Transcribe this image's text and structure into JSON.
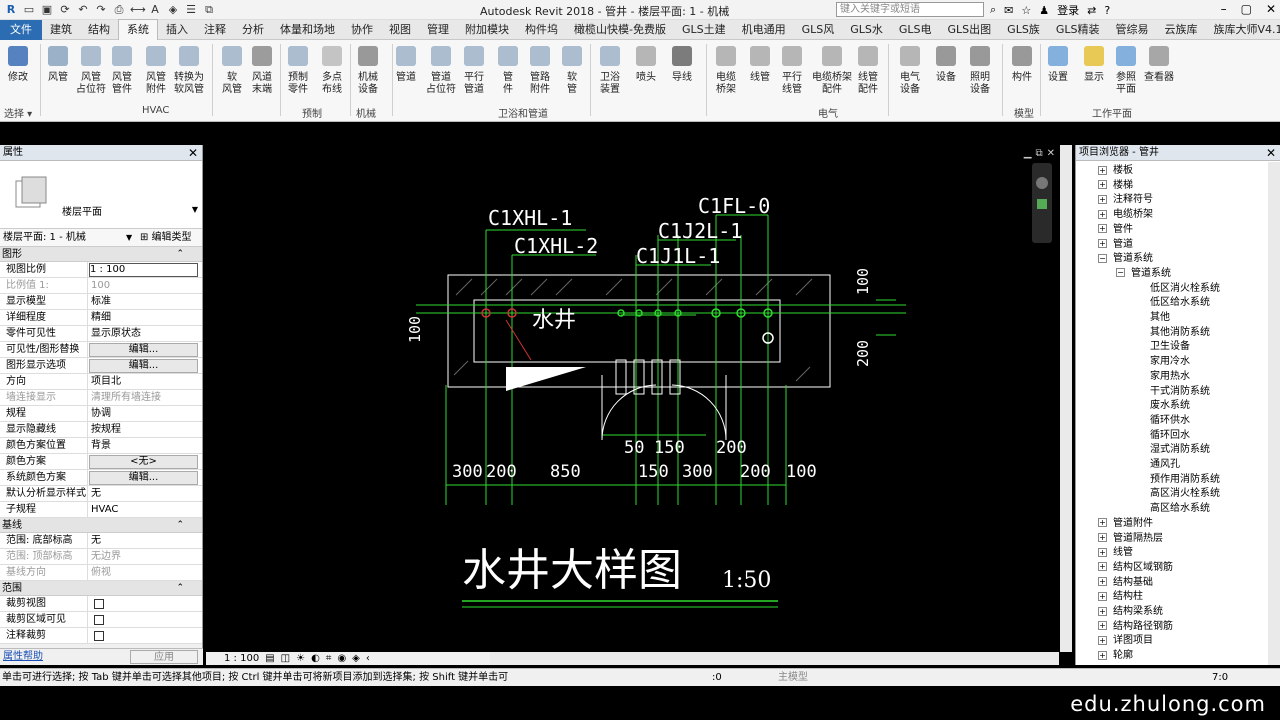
{
  "app_title": "Autodesk Revit 2018 -   管井 - 楼层平面: 1 - 机械",
  "search_placeholder": "键入关键字或短语",
  "login": "登录",
  "tabs": [
    "文件",
    "建筑",
    "结构",
    "系统",
    "插入",
    "注释",
    "分析",
    "体量和场地",
    "协作",
    "视图",
    "管理",
    "附加模块",
    "构件坞",
    "橄榄山快模-免费版",
    "GLS土建",
    "机电通用",
    "GLS风",
    "GLS水",
    "GLS电",
    "GLS出图",
    "GLS族",
    "GLS精装",
    "管综易",
    "云族库",
    "族库大师V4.1"
  ],
  "active_tab": "系统",
  "ribbon": {
    "buttons": [
      "修改",
      "风管",
      "风管\n占位符",
      "风管\n管件",
      "风管\n附件",
      "转换为\n软风管",
      "软\n风管",
      "风道\n末端",
      "预制\n零件",
      "多点\n布线",
      "机械\n设备",
      "管道",
      "管道\n占位符",
      "平行\n管道",
      "管\n件",
      "管路\n附件",
      "软\n管",
      "卫浴\n装置",
      "喷头",
      "导线",
      "电缆\n桥架",
      "线管",
      "平行\n线管",
      "电缆桥架\n配件",
      "线管\n配件",
      "电气\n设备",
      "设备",
      "照明\n设备",
      "构件",
      "设置",
      "显示",
      "参照\n平面",
      "查看器"
    ],
    "groups": [
      "选择 ▾",
      "HVAC",
      "预制",
      "机械",
      "卫浴和管道",
      "电气",
      "模型",
      "工作平面"
    ]
  },
  "properties": {
    "title": "属性",
    "type_name": "楼层平面",
    "instance": "楼层平面: 1 - 机械",
    "edit_type": "编辑类型",
    "sections": {
      "graphics": "图形",
      "underlay": "基线",
      "extents": "范围"
    },
    "rows": [
      [
        "视图比例",
        "1 : 100"
      ],
      [
        "比例值 1:",
        "100"
      ],
      [
        "显示模型",
        "标准"
      ],
      [
        "详细程度",
        "精细"
      ],
      [
        "零件可见性",
        "显示原状态"
      ],
      [
        "可见性/图形替换",
        "编辑..."
      ],
      [
        "图形显示选项",
        "编辑..."
      ],
      [
        "方向",
        "项目北"
      ],
      [
        "墙连接显示",
        "清理所有墙连接"
      ],
      [
        "规程",
        "协调"
      ],
      [
        "显示隐藏线",
        "按规程"
      ],
      [
        "颜色方案位置",
        "背景"
      ],
      [
        "颜色方案",
        "<无>"
      ],
      [
        "系统颜色方案",
        "编辑..."
      ],
      [
        "默认分析显示样式",
        "无"
      ],
      [
        "子规程",
        "HVAC"
      ]
    ],
    "underlay_rows": [
      [
        "范围: 底部标高",
        "无"
      ],
      [
        "范围: 顶部标高",
        "无边界"
      ],
      [
        "基线方向",
        "俯视"
      ]
    ],
    "extents_rows": [
      "裁剪视图",
      "裁剪区域可见",
      "注释裁剪"
    ],
    "help": "属性帮助",
    "apply": "应用"
  },
  "drawing": {
    "pipe_labels": [
      "C1XHL-1",
      "C1XHL-2",
      "C1FL-0",
      "C1J2L-1",
      "C1J1L-1"
    ],
    "shaft_label": "水井",
    "title": "水井大样图",
    "scale": "1:50",
    "dims_bottom": [
      "300",
      "200",
      "850",
      "150",
      "300",
      "200",
      "100"
    ],
    "dims_inner": [
      "50",
      "150",
      "200"
    ],
    "dims_side": [
      "100",
      "100",
      "200"
    ]
  },
  "view_scale": "1 : 100",
  "browser": {
    "title": "项目浏览器 - 管井",
    "items": [
      {
        "label": "楼板",
        "level": 0,
        "exp": "+"
      },
      {
        "label": "楼梯",
        "level": 0,
        "exp": "+"
      },
      {
        "label": "注释符号",
        "level": 0,
        "exp": "+"
      },
      {
        "label": "电缆桥架",
        "level": 0,
        "exp": "+"
      },
      {
        "label": "管件",
        "level": 0,
        "exp": "+"
      },
      {
        "label": "管道",
        "level": 0,
        "exp": "+"
      },
      {
        "label": "管道系统",
        "level": 0,
        "exp": "-"
      },
      {
        "label": "管道系统",
        "level": 1,
        "exp": "-"
      },
      {
        "label": "低区消火栓系统",
        "level": 2,
        "exp": ""
      },
      {
        "label": "低区给水系统",
        "level": 2,
        "exp": ""
      },
      {
        "label": "其他",
        "level": 2,
        "exp": ""
      },
      {
        "label": "其他消防系统",
        "level": 2,
        "exp": ""
      },
      {
        "label": "卫生设备",
        "level": 2,
        "exp": ""
      },
      {
        "label": "家用冷水",
        "level": 2,
        "exp": ""
      },
      {
        "label": "家用热水",
        "level": 2,
        "exp": ""
      },
      {
        "label": "干式消防系统",
        "level": 2,
        "exp": ""
      },
      {
        "label": "废水系统",
        "level": 2,
        "exp": ""
      },
      {
        "label": "循环供水",
        "level": 2,
        "exp": ""
      },
      {
        "label": "循环回水",
        "level": 2,
        "exp": ""
      },
      {
        "label": "湿式消防系统",
        "level": 2,
        "exp": ""
      },
      {
        "label": "通风孔",
        "level": 2,
        "exp": ""
      },
      {
        "label": "预作用消防系统",
        "level": 2,
        "exp": ""
      },
      {
        "label": "高区消火栓系统",
        "level": 2,
        "exp": ""
      },
      {
        "label": "高区给水系统",
        "level": 2,
        "exp": ""
      },
      {
        "label": "管道附件",
        "level": 0,
        "exp": "+"
      },
      {
        "label": "管道隔热层",
        "level": 0,
        "exp": "+"
      },
      {
        "label": "线管",
        "level": 0,
        "exp": "+"
      },
      {
        "label": "结构区域钢筋",
        "level": 0,
        "exp": "+"
      },
      {
        "label": "结构基础",
        "level": 0,
        "exp": "+"
      },
      {
        "label": "结构柱",
        "level": 0,
        "exp": "+"
      },
      {
        "label": "结构梁系统",
        "level": 0,
        "exp": "+"
      },
      {
        "label": "结构路径钢筋",
        "level": 0,
        "exp": "+"
      },
      {
        "label": "详图项目",
        "level": 0,
        "exp": "+"
      },
      {
        "label": "轮廓",
        "level": 0,
        "exp": "+"
      }
    ]
  },
  "status": {
    "text": "单击可进行选择; 按 Tab 键并单击可选择其他项目; 按 Ctrl 键并单击可将新项目添加到选择集; 按 Shift 键并单击可",
    "count": ":0",
    "model": "主模型",
    "filter": "7:0"
  },
  "watermark": "edu.zhulong.com"
}
